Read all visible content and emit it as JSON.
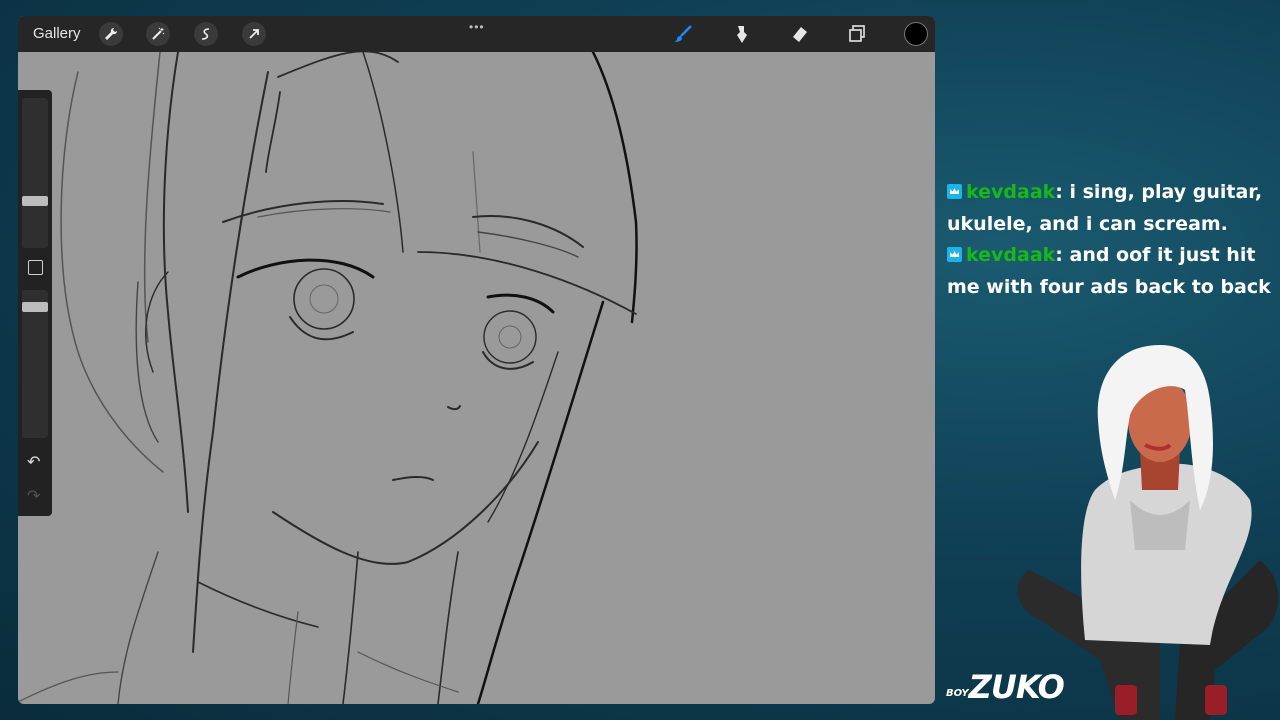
{
  "toolbar": {
    "gallery_label": "Gallery",
    "left_tools": [
      "wrench-icon",
      "magic-wand-icon",
      "selection-icon",
      "move-arrow-icon"
    ],
    "right_tools": [
      "brush-icon",
      "smudge-icon",
      "eraser-icon",
      "layers-icon"
    ],
    "active_tool": "brush-icon",
    "active_color": "#000000",
    "accent": "#1a8cff"
  },
  "chat": {
    "messages": [
      {
        "user": "kevdaak",
        "text": ": i sing, play guitar, ukulele, and i can scream."
      },
      {
        "user": "kevdaak",
        "text": ": and oof it just hit me with four ads back to back"
      }
    ],
    "username_color": "#18b818",
    "badge_color": "#1eb4e8"
  },
  "logo": {
    "small": "BOY",
    "big": "ZUKO"
  }
}
